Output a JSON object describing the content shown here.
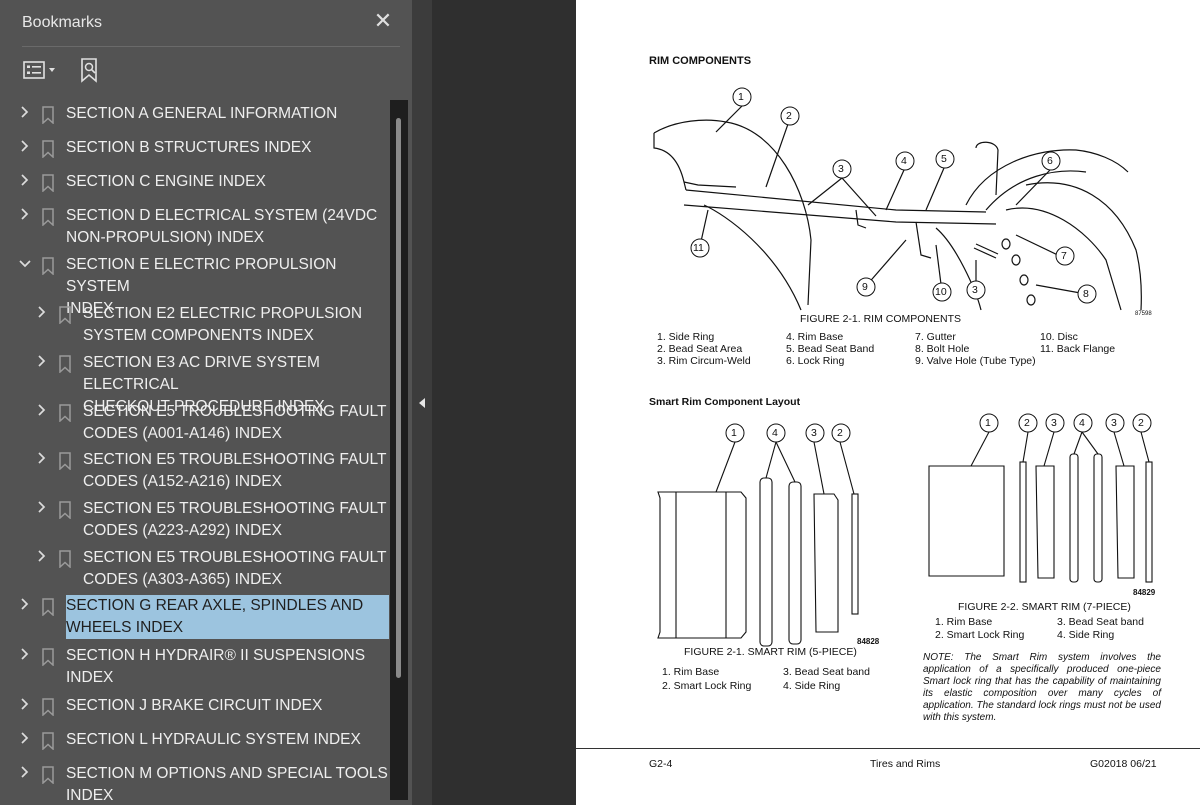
{
  "panel": {
    "title": "Bookmarks",
    "tools": [
      "options-menu",
      "add-bookmark"
    ]
  },
  "bookmarks": [
    {
      "label": "SECTION A GENERAL INFORMATION",
      "level": 0,
      "expanded": false,
      "selected": false
    },
    {
      "label": "SECTION B STRUCTURES INDEX",
      "level": 0,
      "expanded": false,
      "selected": false
    },
    {
      "label": "SECTION C ENGINE INDEX",
      "level": 0,
      "expanded": false,
      "selected": false
    },
    {
      "label": "SECTION D ELECTRICAL SYSTEM (24VDC\nNON-PROPULSION) INDEX",
      "level": 0,
      "expanded": false,
      "selected": false
    },
    {
      "label": "SECTION E ELECTRIC PROPULSION SYSTEM\nINDEX",
      "level": 0,
      "expanded": true,
      "selected": false
    },
    {
      "label": "SECTION E2 ELECTRIC PROPULSION\nSYSTEM COMPONENTS INDEX",
      "level": 1,
      "expanded": false,
      "selected": false
    },
    {
      "label": "SECTION E3 AC DRIVE SYSTEM ELECTRICAL\nCHECKOUT PROCEDURE INDEX",
      "level": 1,
      "expanded": false,
      "selected": false
    },
    {
      "label": "SECTION E5 TROUBLESHOOTING FAULT\nCODES (A001-A146) INDEX",
      "level": 1,
      "expanded": false,
      "selected": false
    },
    {
      "label": "SECTION E5 TROUBLESHOOTING FAULT\nCODES (A152-A216) INDEX",
      "level": 1,
      "expanded": false,
      "selected": false
    },
    {
      "label": "SECTION E5 TROUBLESHOOTING FAULT\nCODES (A223-A292) INDEX",
      "level": 1,
      "expanded": false,
      "selected": false
    },
    {
      "label": "SECTION E5 TROUBLESHOOTING FAULT\nCODES (A303-A365) INDEX",
      "level": 1,
      "expanded": false,
      "selected": false
    },
    {
      "label": "SECTION G REAR AXLE, SPINDLES AND\nWHEELS INDEX",
      "level": 0,
      "expanded": false,
      "selected": true
    },
    {
      "label": "SECTION H HYDRAIR® II SUSPENSIONS\nINDEX",
      "level": 0,
      "expanded": false,
      "selected": false
    },
    {
      "label": "SECTION J BRAKE CIRCUIT INDEX",
      "level": 0,
      "expanded": false,
      "selected": false
    },
    {
      "label": "SECTION L HYDRAULIC SYSTEM INDEX",
      "level": 0,
      "expanded": false,
      "selected": false
    },
    {
      "label": "SECTION M OPTIONS AND SPECIAL TOOLS\nINDEX",
      "level": 0,
      "expanded": false,
      "selected": false
    }
  ],
  "document": {
    "heading": "RIM COMPONENTS",
    "figure1": {
      "callouts": [
        "1",
        "2",
        "3",
        "4",
        "5",
        "6",
        "7",
        "8",
        "9",
        "10",
        "3",
        "11"
      ],
      "drawing_id": "87598",
      "caption": "FIGURE 2-1. RIM COMPONENTS",
      "legend": [
        [
          "1. Side Ring",
          "2. Bead Seat Area",
          "3. Rim Circum-Weld"
        ],
        [
          "4. Rim Base",
          "5. Bead Seat Band",
          "6. Lock Ring"
        ],
        [
          "7. Gutter",
          "8. Bolt Hole",
          "9. Valve Hole (Tube Type)"
        ],
        [
          "10. Disc",
          "11. Back Flange"
        ]
      ]
    },
    "smart_heading": "Smart Rim Component Layout",
    "figure2": {
      "callouts": [
        "1",
        "4",
        "3",
        "2"
      ],
      "drawing_id": "84828",
      "caption": "FIGURE 2-1. SMART RIM (5-PIECE)",
      "legend": [
        [
          "1. Rim Base",
          "2. Smart Lock Ring"
        ],
        [
          "3. Bead Seat band",
          "4. Side Ring"
        ]
      ]
    },
    "figure3": {
      "callouts": [
        "1",
        "2",
        "3",
        "4",
        "3",
        "2"
      ],
      "drawing_id": "84829",
      "caption": "FIGURE 2-2. SMART RIM (7-PIECE)",
      "legend": [
        [
          "1. Rim Base",
          "2. Smart Lock Ring"
        ],
        [
          "3. Bead Seat band",
          "4. Side Ring"
        ]
      ]
    },
    "note": "NOTE: The Smart Rim system involves the application of a specifically produced one-piece Smart lock ring that has the capability of maintaining its elastic composition over many cycles of application. The standard lock rings must not be used with this system.",
    "footer": {
      "left": "G2-4",
      "center": "Tires and Rims",
      "right": "G02018  06/21"
    }
  }
}
